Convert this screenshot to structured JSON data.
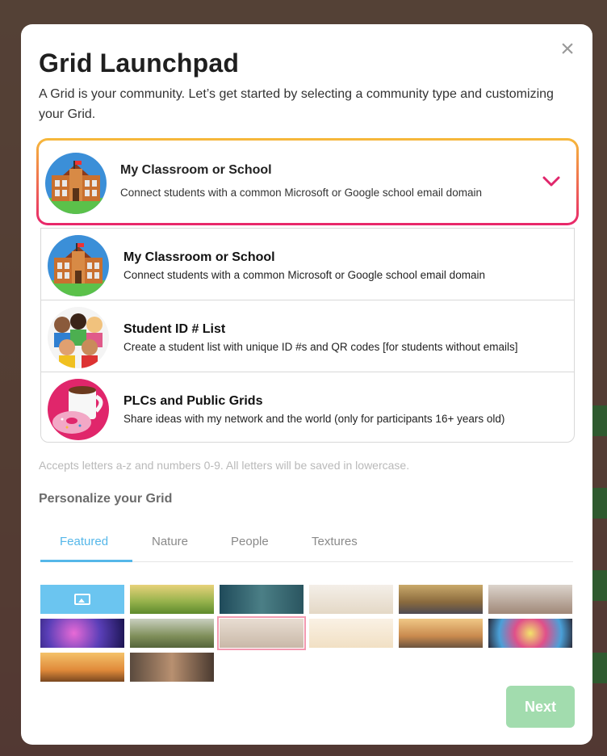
{
  "modal": {
    "title": "Grid Launchpad",
    "subtitle": "A Grid is your community. Let’s get started by selecting a community type and customizing your Grid.",
    "close_icon": "close-icon"
  },
  "selected_type": {
    "title": "My Classroom or School",
    "description": "Connect students with a common Microsoft or Google school email domain",
    "icon": "school-building-icon"
  },
  "options": [
    {
      "title": "My Classroom or School",
      "description": "Connect students with a common Microsoft or Google school email domain",
      "icon": "school-building-icon"
    },
    {
      "title": "Student ID # List",
      "description": "Create a student list with unique ID #s and QR codes [for students without emails]",
      "icon": "students-group-icon"
    },
    {
      "title": "PLCs and Public Grids",
      "description": "Share ideas with my network and the world (only for participants 16+ years old)",
      "icon": "coffee-donut-icon"
    }
  ],
  "hint": "Accepts letters a-z and numbers 0-9. All letters will be saved in lowercase.",
  "personalize": {
    "label": "Personalize your Grid",
    "tabs": [
      "Featured",
      "Nature",
      "People",
      "Textures"
    ],
    "active_tab": "Featured",
    "selected_thumbnail": 8
  },
  "next_label": "Next",
  "colors": {
    "accent_blue": "#55b7e9",
    "next_button": "#a2dcae",
    "select_gradient_top": "#f6b93b",
    "select_gradient_bottom": "#e8266b"
  }
}
